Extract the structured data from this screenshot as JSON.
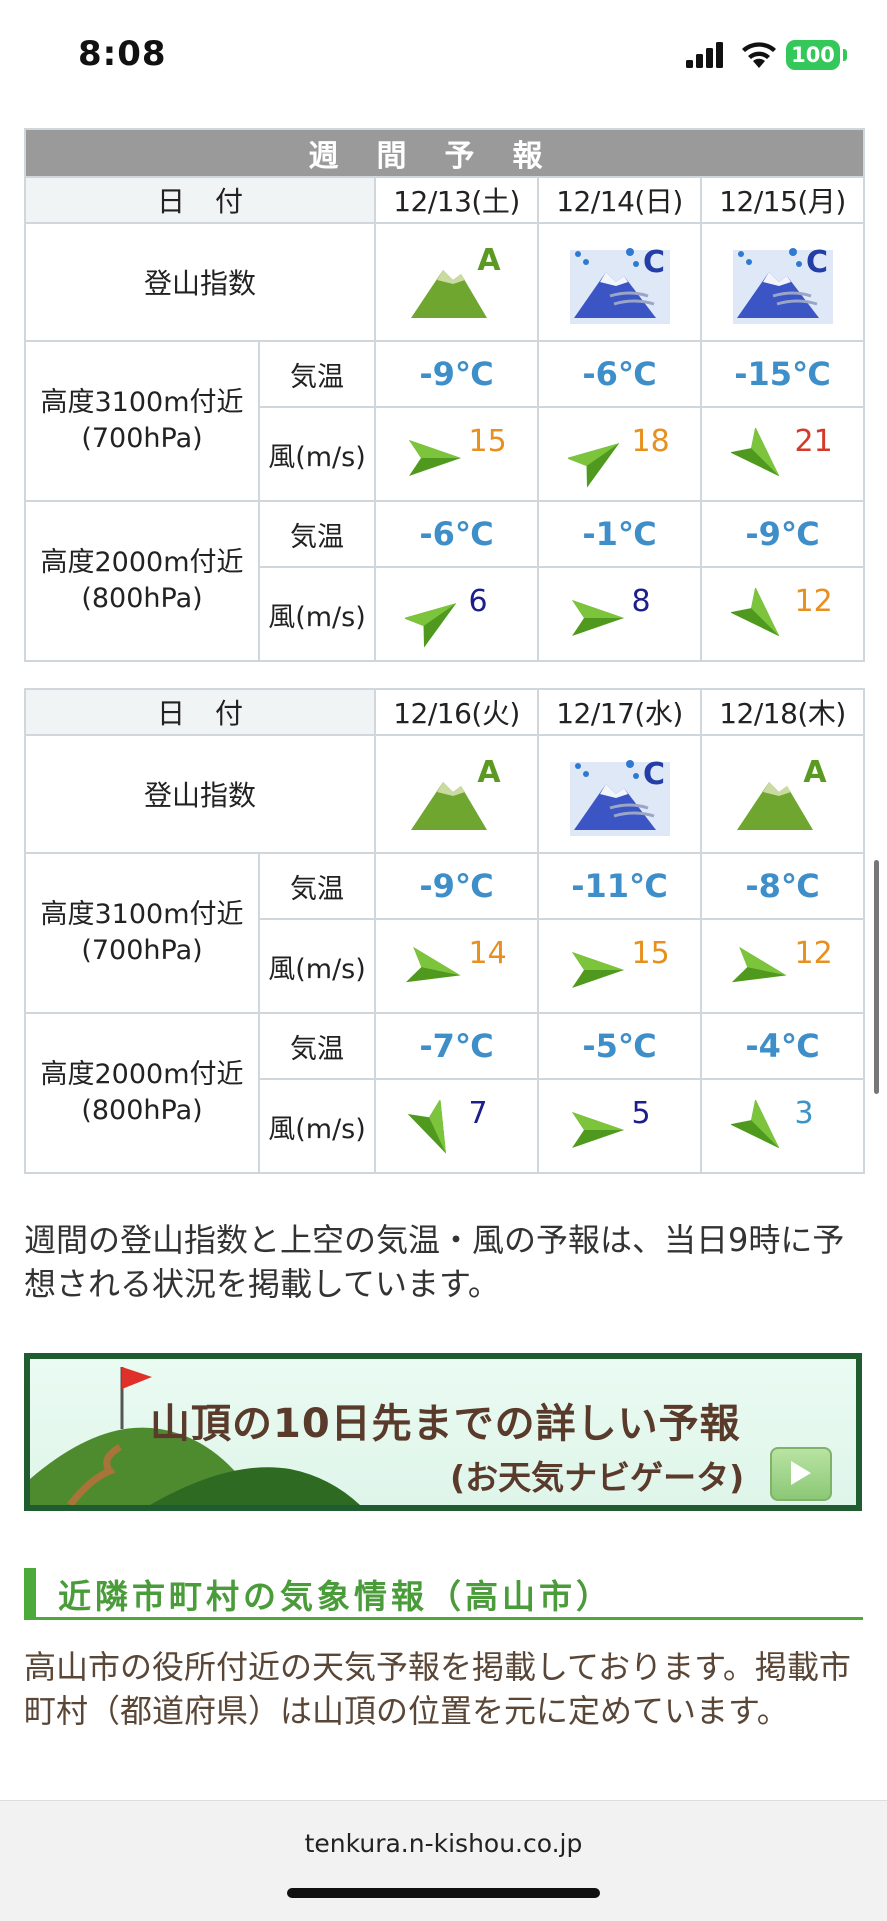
{
  "status": {
    "time": "8:08",
    "battery": "100"
  },
  "weekly": {
    "title": "週間予報",
    "date_label": "日付",
    "index_label": "登山指数",
    "temp_label": "気温",
    "wind_label": "風(m/s)",
    "alt3100": {
      "line1": "高度3100m付近",
      "line2": "(700hPa)"
    },
    "alt2000": {
      "line1": "高度2000m付近",
      "line2": "(800hPa)"
    },
    "weeks": [
      {
        "days": [
          {
            "date": "12/13(土)",
            "index": "A",
            "t3100": "-9℃",
            "w3100": "15",
            "t2000": "-6℃",
            "w2000": "6"
          },
          {
            "date": "12/14(日)",
            "index": "C",
            "t3100": "-6℃",
            "w3100": "18",
            "t2000": "-1℃",
            "w2000": "8"
          },
          {
            "date": "12/15(月)",
            "index": "C",
            "t3100": "-15℃",
            "w3100": "21",
            "t2000": "-9℃",
            "w2000": "12"
          }
        ]
      },
      {
        "days": [
          {
            "date": "12/16(火)",
            "index": "A",
            "t3100": "-9℃",
            "w3100": "14",
            "t2000": "-7℃",
            "w2000": "7"
          },
          {
            "date": "12/17(水)",
            "index": "C",
            "t3100": "-11℃",
            "w3100": "15",
            "t2000": "-5℃",
            "w2000": "5"
          },
          {
            "date": "12/18(木)",
            "index": "A",
            "t3100": "-8℃",
            "w3100": "12",
            "t2000": "-4℃",
            "w2000": "3"
          }
        ]
      }
    ]
  },
  "colors": {
    "index_A": "#5f9a2c",
    "index_C": "#3b55c4",
    "wind_strong": "#e8901f",
    "wind_severe": "#d43a2a",
    "wind_light": "#1d1d8c",
    "temp": "#3d8ec9"
  },
  "note": "週間の登山指数と上空の気温・風の予報は、当日9時に予想される状況を掲載しています。",
  "banner": {
    "title": "山頂の10日先までの詳しい予報",
    "subtitle": "(お天気ナビゲータ)"
  },
  "nearby": {
    "heading": "近隣市町村の気象情報（高山市）",
    "text": "高山市の役所付近の天気予報を掲載しております。掲載市町村（都道府県）は山頂の位置を元に定めています。"
  },
  "browser": {
    "url": "tenkura.n-kishou.co.jp"
  }
}
